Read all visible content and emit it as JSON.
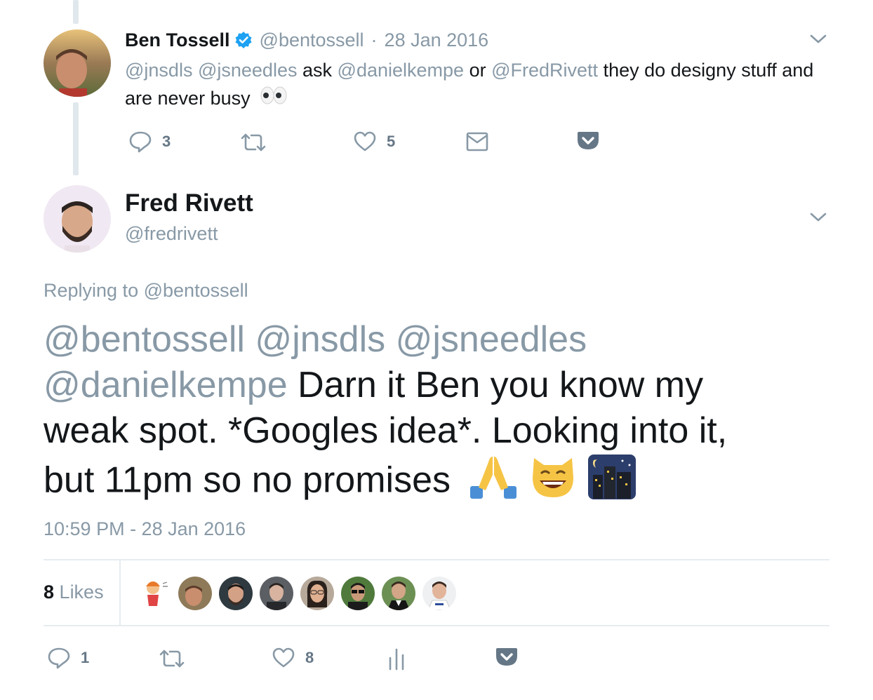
{
  "parent_tweet": {
    "author_name": "Ben Tossell",
    "handle": "@bentossell",
    "separator": "·",
    "date": "28 Jan 2016",
    "text": {
      "m1": "@jnsdls",
      "m2": "@jsneedles",
      "w1": "ask",
      "m3": "@danielkempe",
      "w2": "or",
      "m4": "@FredRivett",
      "w3": "they do designy stuff and",
      "line2": "are never busy"
    },
    "actions": {
      "reply_count": "3",
      "like_count": "5"
    }
  },
  "main_tweet": {
    "author_name": "Fred Rivett",
    "handle": "@fredrivett",
    "replying_label": "Replying to",
    "replying_handle": "@bentossell",
    "text": {
      "m1": "@bentossell",
      "m2": "@jnsdls",
      "m3": "@jsneedles",
      "m4": "@danielkempe",
      "t1": "Darn it Ben you know my",
      "t2": "weak spot. *Googles idea*. Looking into it,",
      "t3": "but 11pm so no promises"
    },
    "timestamp": "10:59 PM - 28 Jan 2016",
    "likes_count": "8",
    "likes_label": "Likes",
    "actions": {
      "reply_count": "1",
      "like_count": "8"
    }
  },
  "colors": {
    "muted": "#8899a6",
    "icon": "#8899a6",
    "verified": "#1da1f2",
    "pocket": "#657786"
  }
}
